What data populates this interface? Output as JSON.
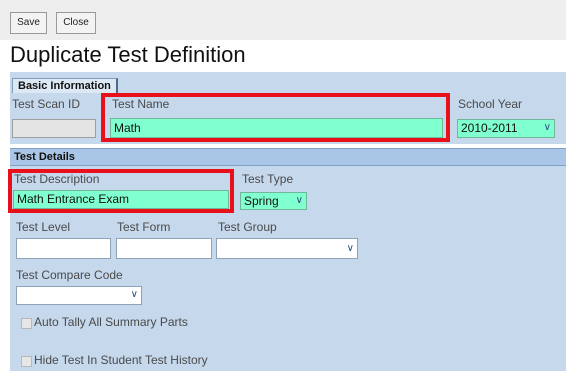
{
  "toolbar": {
    "save_label": "Save",
    "close_label": "Close"
  },
  "page": {
    "title": "Duplicate Test Definition"
  },
  "tabs": {
    "basic_information": "Basic Information"
  },
  "basic": {
    "test_scan_id_label": "Test Scan ID",
    "test_scan_id_value": "",
    "test_name_label": "Test Name",
    "test_name_value": "Math",
    "school_year_label": "School Year",
    "school_year_value": "2010-2011"
  },
  "details": {
    "header": "Test Details",
    "test_description_label": "Test Description",
    "test_description_value": "Math Entrance Exam",
    "test_type_label": "Test Type",
    "test_type_value": "Spring",
    "test_level_label": "Test Level",
    "test_level_value": "",
    "test_form_label": "Test Form",
    "test_form_value": "",
    "test_group_label": "Test Group",
    "test_group_value": "",
    "test_compare_code_label": "Test Compare Code",
    "test_compare_code_value": "",
    "auto_tally_label": "Auto Tally All Summary Parts",
    "hide_test_label": "Hide Test In Student Test History"
  },
  "icons": {
    "dropdown_arrow": "chevron-down-icon"
  },
  "colors": {
    "highlight_field": "#80ffcf",
    "annotation_box": "#e8101a",
    "panel": "#c6d8ec",
    "section_header": "#a9c6e6"
  }
}
